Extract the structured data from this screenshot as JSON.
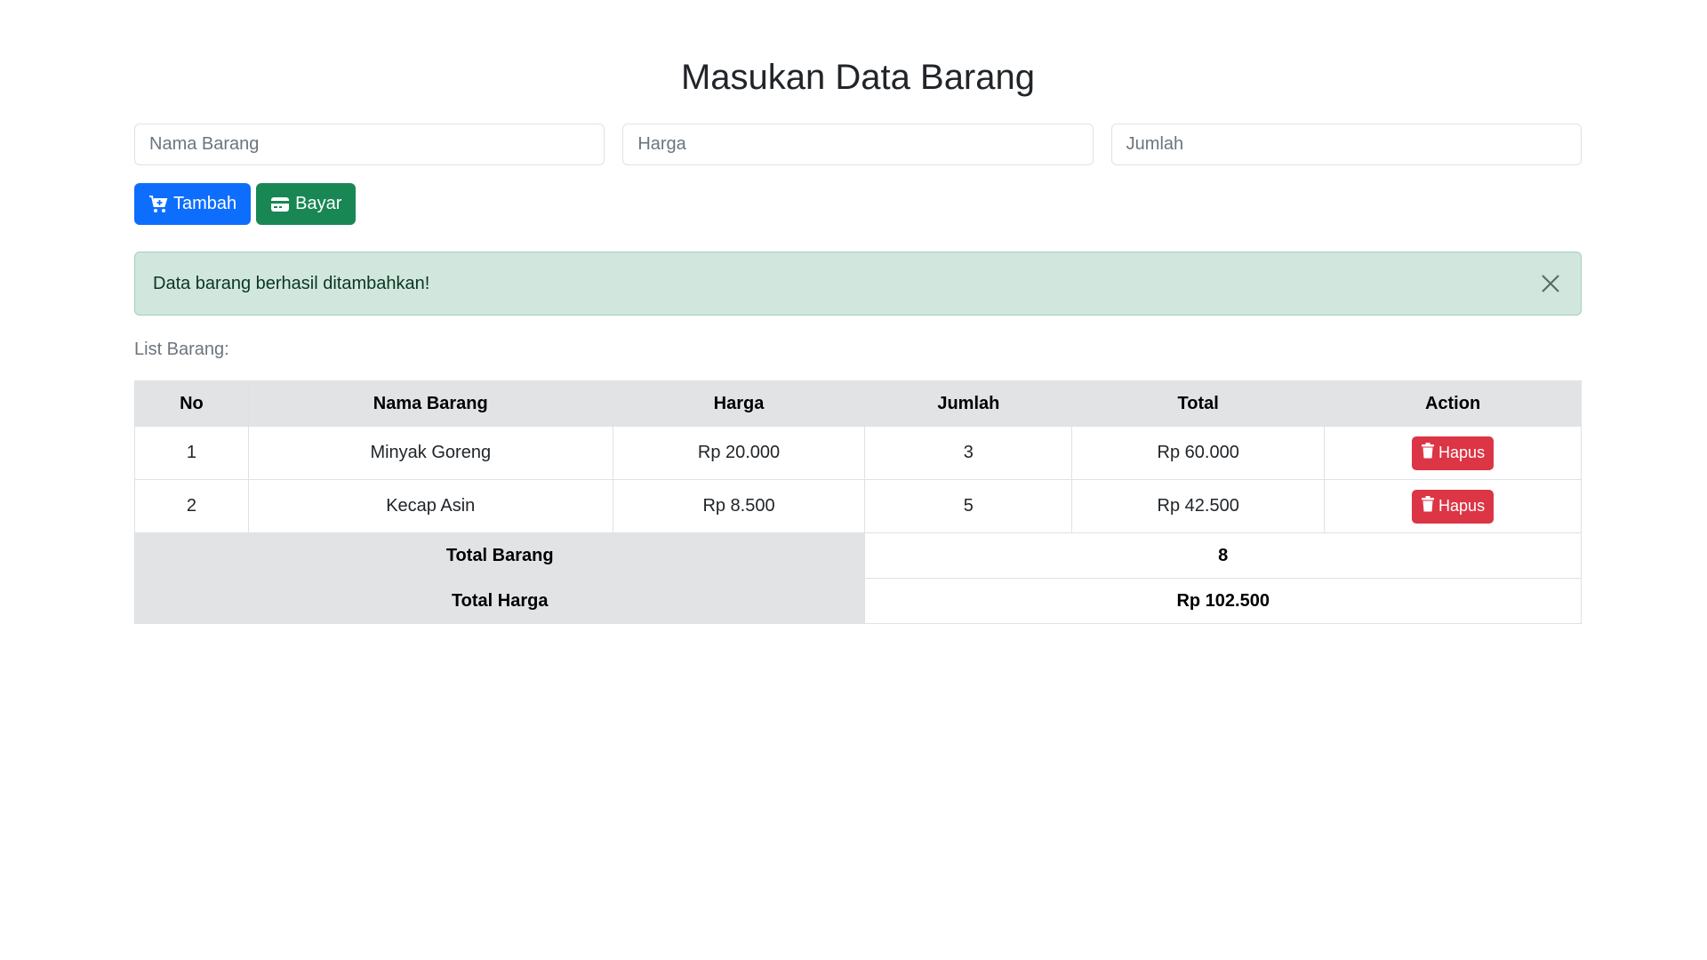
{
  "page": {
    "title": "Masukan Data Barang"
  },
  "form": {
    "nama_placeholder": "Nama Barang",
    "harga_placeholder": "Harga",
    "jumlah_placeholder": "Jumlah",
    "nama_value": "",
    "harga_value": "",
    "jumlah_value": ""
  },
  "buttons": {
    "tambah_label": "Tambah",
    "tambah_icon": "cart-plus-icon",
    "bayar_label": "Bayar",
    "bayar_icon": "credit-card-icon"
  },
  "alert": {
    "message": "Data barang berhasil ditambahkan!",
    "close_icon": "close-icon"
  },
  "list": {
    "label": "List Barang:",
    "headers": [
      "No",
      "Nama Barang",
      "Harga",
      "Jumlah",
      "Total",
      "Action"
    ],
    "rows": [
      {
        "no": "1",
        "nama": "Minyak Goreng",
        "harga": "Rp 20.000",
        "jumlah": "3",
        "total": "Rp 60.000",
        "action": "Hapus"
      },
      {
        "no": "2",
        "nama": "Kecap Asin",
        "harga": "Rp 8.500",
        "jumlah": "5",
        "total": "Rp 42.500",
        "action": "Hapus"
      }
    ],
    "delete_icon": "trash-icon",
    "summary": {
      "total_barang_label": "Total Barang",
      "total_barang_value": "8",
      "total_harga_label": "Total Harga",
      "total_harga_value": "Rp 102.500"
    }
  },
  "colors": {
    "primary": "#0d6efd",
    "success": "#198754",
    "danger": "#dc3545",
    "alert_bg": "#d1e7dd",
    "header_bg": "#e2e3e5"
  }
}
